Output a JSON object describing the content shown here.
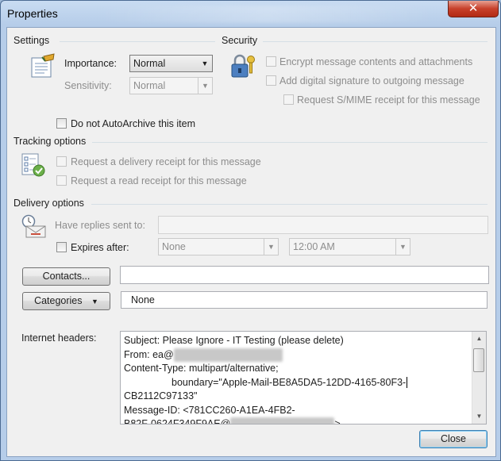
{
  "window": {
    "title": "Properties",
    "close_glyph": "✕"
  },
  "settings": {
    "group_label": "Settings",
    "importance_label": "Importance:",
    "importance_value": "Normal",
    "sensitivity_label": "Sensitivity:",
    "sensitivity_value": "Normal",
    "autoarchive_label": "Do not AutoArchive this item"
  },
  "security": {
    "group_label": "Security",
    "encrypt_label": "Encrypt message contents and attachments",
    "signature_label": "Add digital signature to outgoing message",
    "smime_label": "Request S/MIME receipt for this message"
  },
  "tracking": {
    "group_label": "Tracking options",
    "delivery_receipt_label": "Request a delivery receipt for this message",
    "read_receipt_label": "Request a read receipt for this message"
  },
  "delivery": {
    "group_label": "Delivery options",
    "replies_label": "Have replies sent to:",
    "expires_label": "Expires after:",
    "expires_date": "None",
    "expires_time": "12:00 AM"
  },
  "contacts": {
    "button_label": "Contacts...",
    "value": ""
  },
  "categories": {
    "button_label": "Categories",
    "value": "None"
  },
  "internet_headers": {
    "label": "Internet headers:",
    "lines": [
      "Subject: Please Ignore - IT Testing (please delete)",
      "From: ea@",
      "Content-Type: multipart/alternative;",
      "boundary=\"Apple-Mail-BE8A5DA5-12DD-4165-80F3-",
      "CB2112C97133\"",
      "Message-ID: <781CC260-A1EA-4FB2-",
      "B82F-0624F349F9AE@"
    ],
    "tail": ">"
  },
  "footer": {
    "close_label": "Close"
  },
  "icons": {
    "settings": "properties-sheet-icon",
    "security": "lock-key-icon",
    "tracking": "tracking-checklist-icon",
    "delivery": "clock-envelope-icon"
  }
}
